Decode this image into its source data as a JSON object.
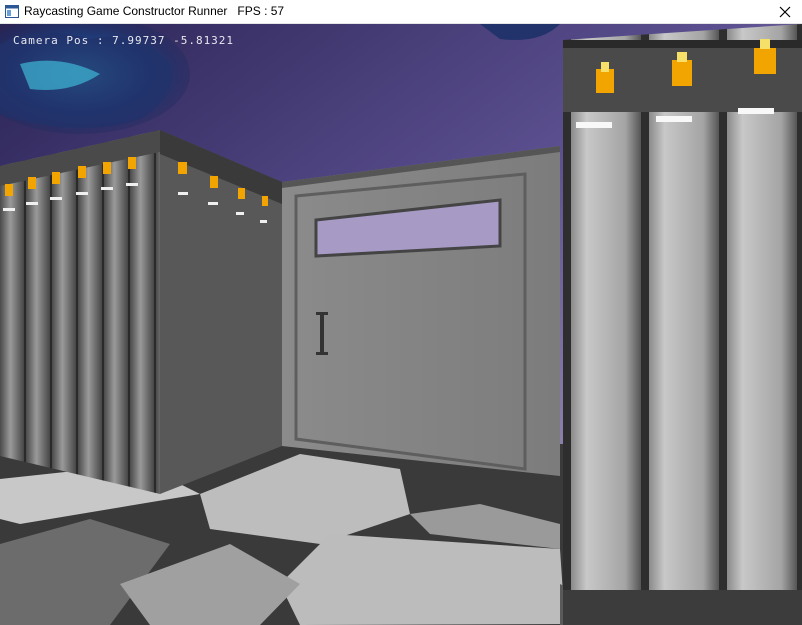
{
  "window": {
    "title": "Raycasting Game Constructor Runner   FPS : 57",
    "app_icon": "window-app-icon",
    "close_icon": "close-icon"
  },
  "hud": {
    "camera_label": "Camera Pos : 7.99737 -5.81321"
  },
  "scene": {
    "sky_colors": [
      "#3d3670",
      "#a89db6"
    ],
    "wall_color": "#9a9a9a",
    "door_color": "#8a8a8a",
    "floor_light": "#bdbdbd",
    "floor_dark": "#3e3e3e",
    "flame_color": "#f2a400"
  }
}
